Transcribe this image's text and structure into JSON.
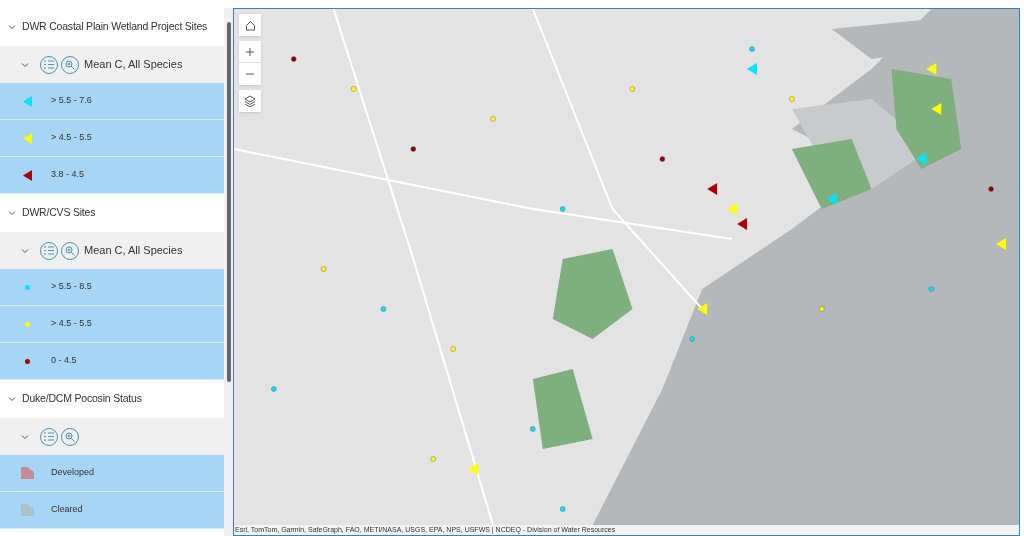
{
  "layers": [
    {
      "title": "DWR Coastal Plain Wetland Project Sites",
      "expanded": true,
      "sublayer": {
        "label": "Mean C, All Species",
        "expanded": true
      },
      "items": [
        {
          "label": "> 5.5 - 7.6",
          "kind": "triangle",
          "color": "#00e5ff"
        },
        {
          "label": "> 4.5 - 5.5",
          "kind": "triangle",
          "color": "#ffff00"
        },
        {
          "label": "3.8 - 4.5",
          "kind": "triangle",
          "color": "#a80000"
        }
      ]
    },
    {
      "title": "DWR/CVS Sites",
      "expanded": true,
      "sublayer": {
        "label": "Mean C, All Species",
        "expanded": true
      },
      "items": [
        {
          "label": "> 5.5 - 8.5",
          "kind": "dot",
          "color": "#00e5ff"
        },
        {
          "label": "> 4.5 - 5.5",
          "kind": "dot",
          "color": "#ffff00"
        },
        {
          "label": "0 - 4.5",
          "kind": "dot",
          "color": "#a80000"
        }
      ]
    },
    {
      "title": "Duke/DCM Pocosin Status",
      "expanded": true,
      "sublayer": {
        "expanded": true
      },
      "items": [
        {
          "label": "Developed",
          "kind": "polygon",
          "color": "#c48a96"
        },
        {
          "label": "Cleared",
          "kind": "polygon",
          "color": "#a9c3c9"
        }
      ]
    }
  ],
  "map": {
    "attribution": "Esri, TomTom, Garmin, SafeGraph, FAO, METI/NASA, USGS, EPA, NPS, USFWS | NCDEQ - Division of Water Resources"
  }
}
